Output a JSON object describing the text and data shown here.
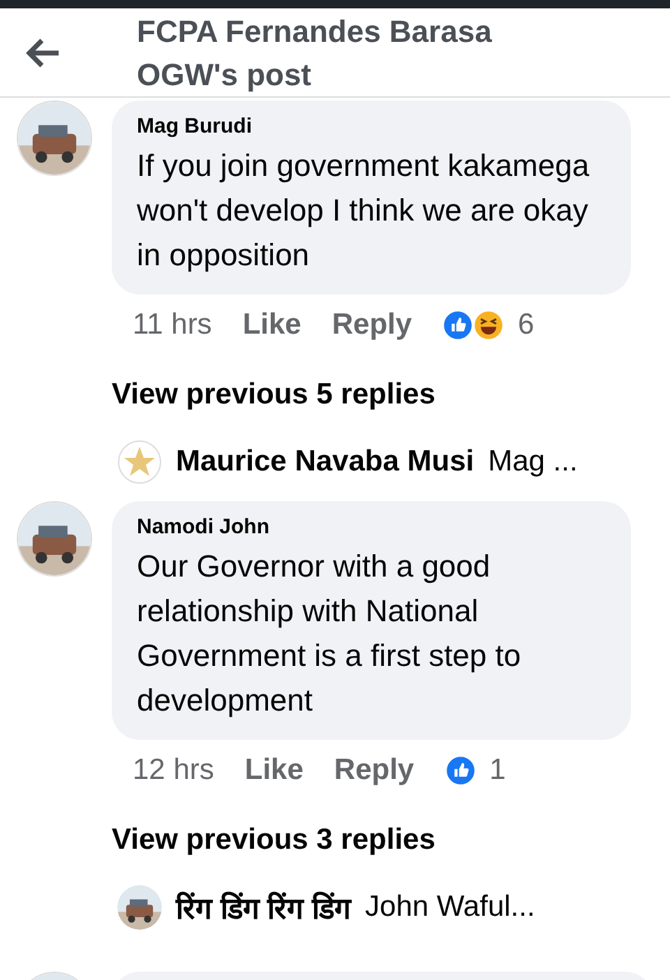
{
  "header": {
    "title": "FCPA Fernandes Barasa OGW's post"
  },
  "feed": [
    {
      "kind": "comment",
      "author": "Mag Burudi",
      "text": "If you join government kakamega won't develop I think we are okay in opposition",
      "time": "11 hrs",
      "like": "Like",
      "reply": "Reply",
      "reactions": [
        {
          "kind": "like"
        },
        {
          "kind": "haha"
        }
      ],
      "count": "6"
    },
    {
      "kind": "view_more",
      "text": "View previous 5 replies"
    },
    {
      "kind": "reply_preview",
      "avatar": {
        "kind": "star"
      },
      "author": "Maurice Navaba Musi",
      "snippet": "Mag ..."
    },
    {
      "kind": "comment",
      "author": "Namodi John",
      "text": "Our Governor with a good relationship with National Government is a first step to development",
      "time": "12 hrs",
      "like": "Like",
      "reply": "Reply",
      "reactions": [
        {
          "kind": "like"
        }
      ],
      "count": "1"
    },
    {
      "kind": "view_more",
      "text": "View previous 3 replies"
    },
    {
      "kind": "reply_preview",
      "author": "रिंग डिंग रिंग डिंग",
      "snippet": "John Waful..."
    },
    {
      "kind": "cut_comment"
    }
  ]
}
